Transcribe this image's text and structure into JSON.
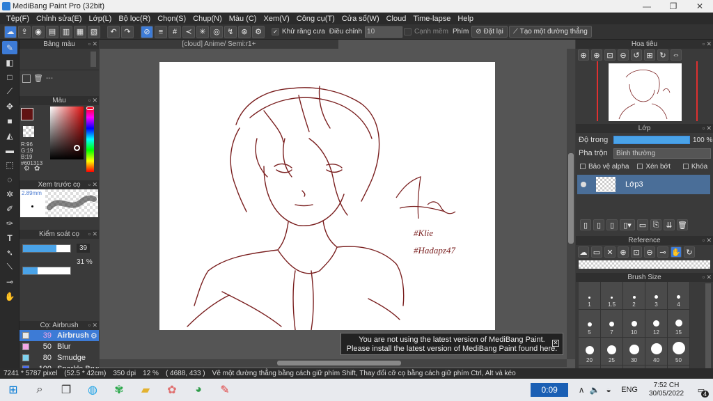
{
  "window": {
    "title": "MediBang Paint Pro (32bit)",
    "minimize": "—",
    "maximize": "❐",
    "close": "✕"
  },
  "menu": [
    "Tệp(F)",
    "Chỉnh sửa(E)",
    "Lớp(L)",
    "Bộ lọc(R)",
    "Chọn(S)",
    "Chụp(N)",
    "Màu (C)",
    "Xem(V)",
    "Công cụ(T)",
    "Cửa sổ(W)",
    "Cloud",
    "Time-lapse",
    "Help"
  ],
  "toolbar": {
    "antialias_label": "Khử răng cưa",
    "adjust_label": "Điều chỉnh",
    "adjust_value": "10",
    "edge_label": "Cạnh mềm",
    "key_label": "Phím",
    "reset_label": "Đặt lại",
    "line_label": "Tạo một đường thẳng"
  },
  "canvas": {
    "tab_title": "[cloud] Anime/ Semi:r1+"
  },
  "panels": {
    "palette_title": "Bảng màu",
    "palette_text": "---",
    "color_title": "Màu",
    "color_rgb": {
      "r": "R:96",
      "g": "G:19",
      "b": "B:19"
    },
    "color_hex": "#601313",
    "color_main": "#601313",
    "preview_title": "Xem trước cọ",
    "preview_size": "2.89mm",
    "brush_control_title": "Kiểm soát cọ",
    "brush_size_value": "39",
    "brush_size_fraction": 0.7,
    "brush_opacity_value": "31 %",
    "brush_opacity_fraction": 0.31,
    "brush_list_title": "Cọ: Airbrush",
    "brushes": [
      {
        "size": "39",
        "name": "Airbrush",
        "color": "#e8e8e8",
        "selected": true
      },
      {
        "size": "50",
        "name": "Blur",
        "color": "#f4a6e6",
        "selected": false
      },
      {
        "size": "80",
        "name": "Smudge",
        "color": "#7fd3f0",
        "selected": false
      },
      {
        "size": "100",
        "name": "Sparkle Brus",
        "color": "#4a6cf0",
        "selected": false
      }
    ]
  },
  "right": {
    "navigator_title": "Hoa tiêu",
    "layer_title": "Lớp",
    "opacity_label": "Độ trong",
    "opacity_value": "100 %",
    "opacity_fraction": 1.0,
    "blend_label": "Pha trộn",
    "blend_value": "Bình thường",
    "protect_alpha": "Bảo vệ alpha",
    "clip_label": "Xén bớt",
    "lock_label": "Khóa",
    "layer_name": "Lớp3",
    "reference_title": "Reference",
    "brush_size_title": "Brush Size",
    "brush_sizes": [
      "1",
      "1.5",
      "2",
      "3",
      "4",
      "5",
      "7",
      "10",
      "12",
      "15",
      "20",
      "25",
      "30",
      "40",
      "50",
      "70",
      "100",
      "150",
      "200",
      "300"
    ]
  },
  "notice": {
    "line1": "You are not using the latest version of MediBang Paint.",
    "line2": "Please install the latest version of MediBang Paint found here."
  },
  "status": {
    "pixels": "7241 * 5787 pixel",
    "size_cm": "(52.5 * 42cm)",
    "dpi": "350 dpi",
    "zoom": "12 %",
    "coords": "( 4688, 433 )",
    "hint": "Vẽ một đường thẳng bằng cách giữ phím Shift, Thay đổi cỡ cọ bằng cách giữ phím Ctrl, Alt và kéo"
  },
  "taskbar": {
    "timer": "0:09",
    "lang": "ENG",
    "time": "7:52 CH",
    "date": "30/05/2022",
    "notif_count": "4"
  },
  "artwork": {
    "sig_line1": "#Klie",
    "sig_line2": "#Hadapz47",
    "stroke_color": "#7a1f1f"
  }
}
